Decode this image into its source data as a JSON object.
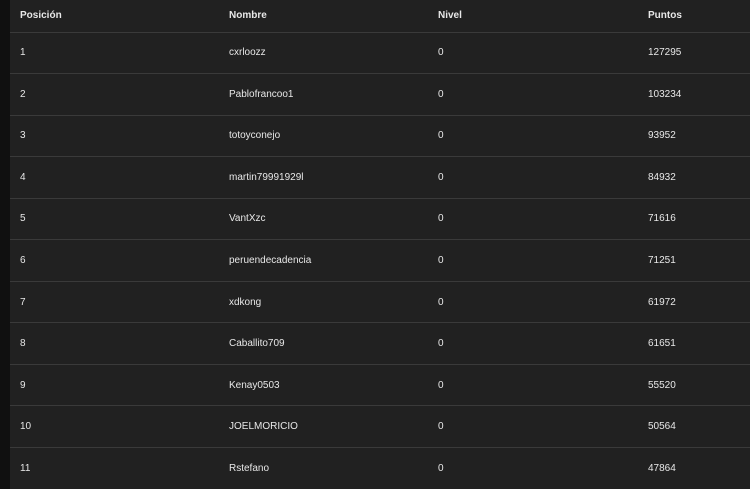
{
  "leaderboard": {
    "columns": [
      "Posición",
      "Nombre",
      "Nivel",
      "Puntos"
    ],
    "rows": [
      [
        "1",
        "cxrloozz",
        "0",
        "127295"
      ],
      [
        "2",
        "Pablofrancoo1",
        "0",
        "103234"
      ],
      [
        "3",
        "totoyconejo",
        "0",
        "93952"
      ],
      [
        "4",
        "martin79991929l",
        "0",
        "84932"
      ],
      [
        "5",
        "VantXzc",
        "0",
        "71616"
      ],
      [
        "6",
        "peruendecadencia",
        "0",
        "71251"
      ],
      [
        "7",
        "xdkong",
        "0",
        "61972"
      ],
      [
        "8",
        "Caballito709",
        "0",
        "61651"
      ],
      [
        "9",
        "Kenay0503",
        "0",
        "55520"
      ],
      [
        "10",
        "JOELMORICIO",
        "0",
        "50564"
      ],
      [
        "11",
        "Rstefano",
        "0",
        "47864"
      ]
    ]
  },
  "colors": {
    "background": "#101010",
    "panel": "#212121",
    "text": "#e8e8e8",
    "divider": "#3a3a3a"
  }
}
